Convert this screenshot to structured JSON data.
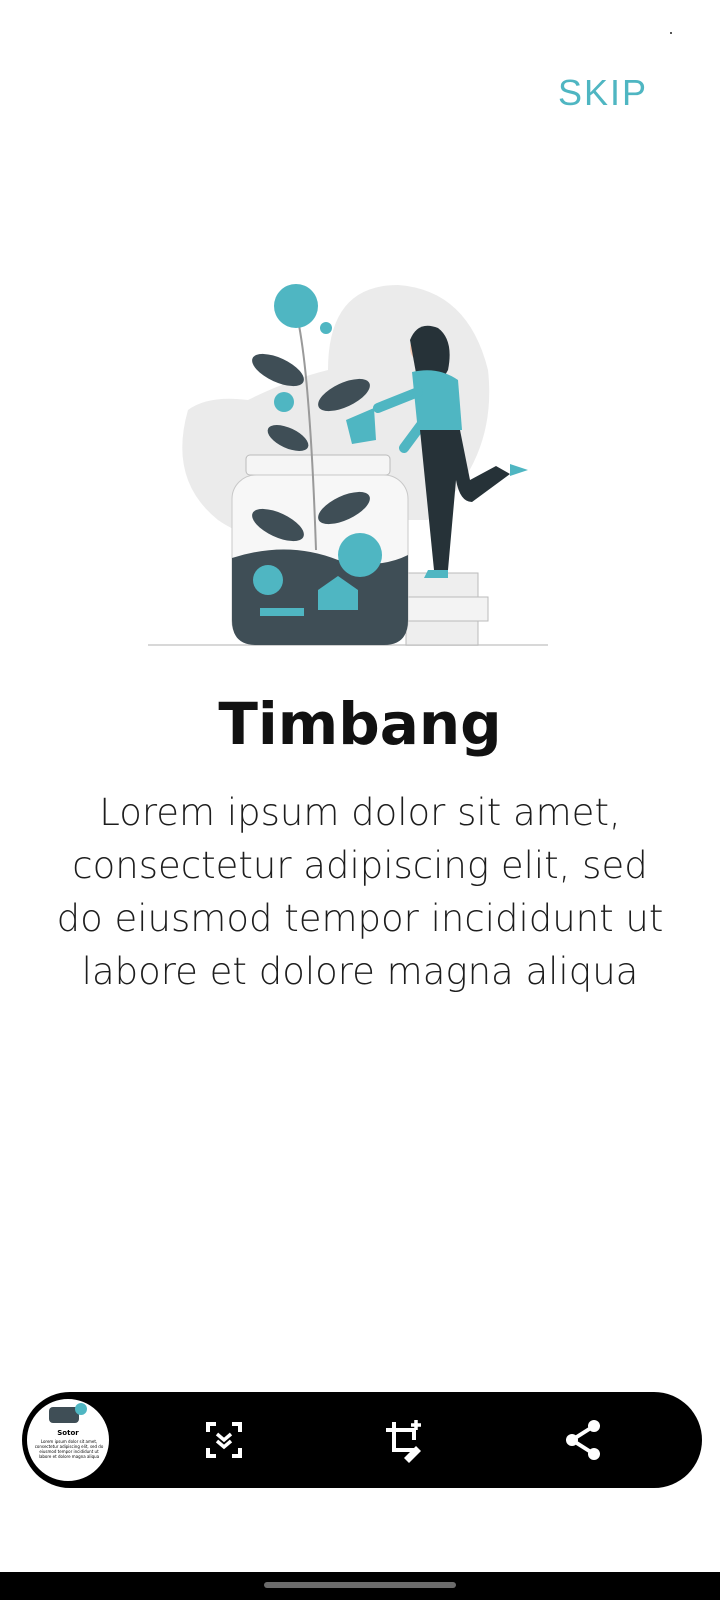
{
  "header": {
    "skip_label": "SKIP"
  },
  "onboarding": {
    "title": "Timbang",
    "description": "Lorem ipsum dolor sit amet, consectetur adipiscing elit, sed do eiusmod tempor incididunt ut labore et dolore magna aliqua"
  },
  "colors": {
    "accent": "#4fb6c2",
    "dark_plant": "#37474f"
  },
  "toolbar": {
    "thumbnail_title": "Sotor",
    "thumbnail_text": "Lorem ipsum dolor sit amet, consectetur adipiscing elit, sed do eiusmod tempor incididunt ut labore et dolore magna aliqua",
    "icons": [
      "scan-icon",
      "crop-edit-icon",
      "share-icon"
    ]
  }
}
